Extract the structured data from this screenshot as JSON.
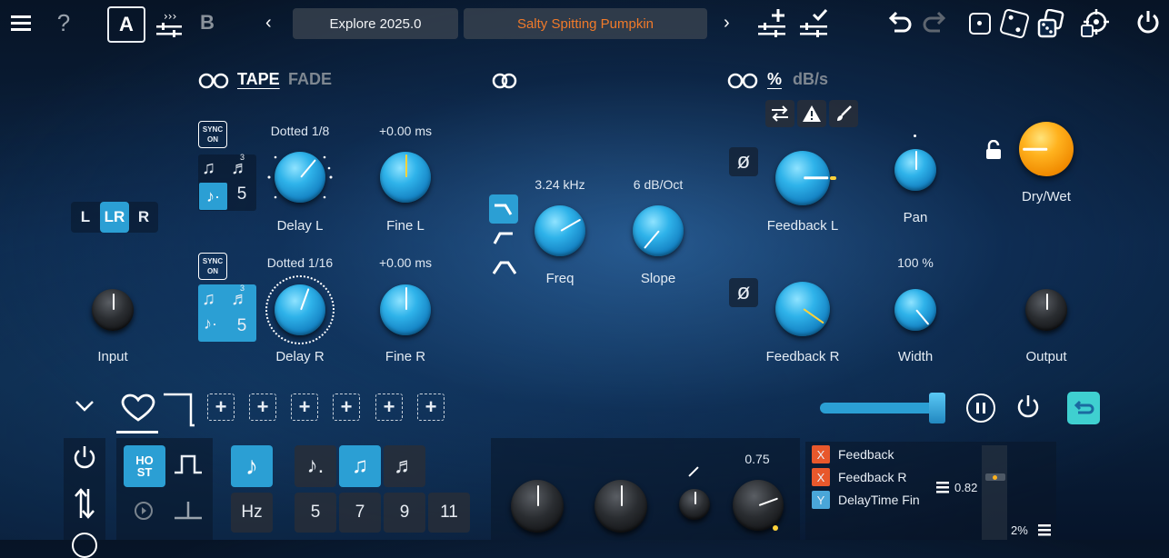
{
  "topbar": {
    "ab": {
      "a_label": "A",
      "b_label": "B"
    },
    "preset_bank": "Explore 2025.0",
    "preset_name": "Salty Spitting Pumpkin",
    "preset_prev": "‹",
    "preset_next": "›"
  },
  "delay_section": {
    "tab_tape": "TAPE",
    "tab_fade": "FADE",
    "sync_label_line1": "SYNC",
    "sync_label_line2": "ON",
    "left": {
      "value": "Dotted 1/8",
      "knob_label": "Delay L",
      "fine_value": "+0.00 ms",
      "fine_label": "Fine L",
      "tuplet": "5"
    },
    "right": {
      "value": "Dotted 1/16",
      "knob_label": "Delay R",
      "fine_value": "+0.00 ms",
      "fine_label": "Fine R",
      "tuplet": "5"
    },
    "channel_select": {
      "l": "L",
      "lr": "LR",
      "r": "R",
      "selected": "LR"
    },
    "input_label": "Input"
  },
  "filter_section": {
    "freq_value": "3.24 kHz",
    "freq_label": "Freq",
    "slope_value": "6 dB/Oct",
    "slope_label": "Slope"
  },
  "feedback_section": {
    "unit_percent": "%",
    "unit_dbs": "dB/s",
    "feedback_l_label": "Feedback L",
    "feedback_r_label": "Feedback R",
    "pan_label": "Pan",
    "width_value": "100 %",
    "width_label": "Width",
    "drywet_label": "Dry/Wet",
    "output_label": "Output",
    "phase_symbol": "ø"
  },
  "bottom": {
    "host_label": "HO\nST",
    "hz_label": "Hz",
    "tuplets": [
      "5",
      "7",
      "9",
      "11"
    ],
    "knob_value": "0.75",
    "mod_targets": [
      {
        "tag": "X",
        "name": "Feedback"
      },
      {
        "tag": "X",
        "name": "Feedback R"
      },
      {
        "tag": "Y",
        "name": "DelayTime Fin"
      }
    ],
    "mod_amount": "0.82",
    "mod_percent": "2%"
  },
  "colors": {
    "accent": "#2b9fd4",
    "preset_name": "#f07a2a",
    "mod_x": "#e8582c",
    "mod_y": "#4aa6d8"
  }
}
